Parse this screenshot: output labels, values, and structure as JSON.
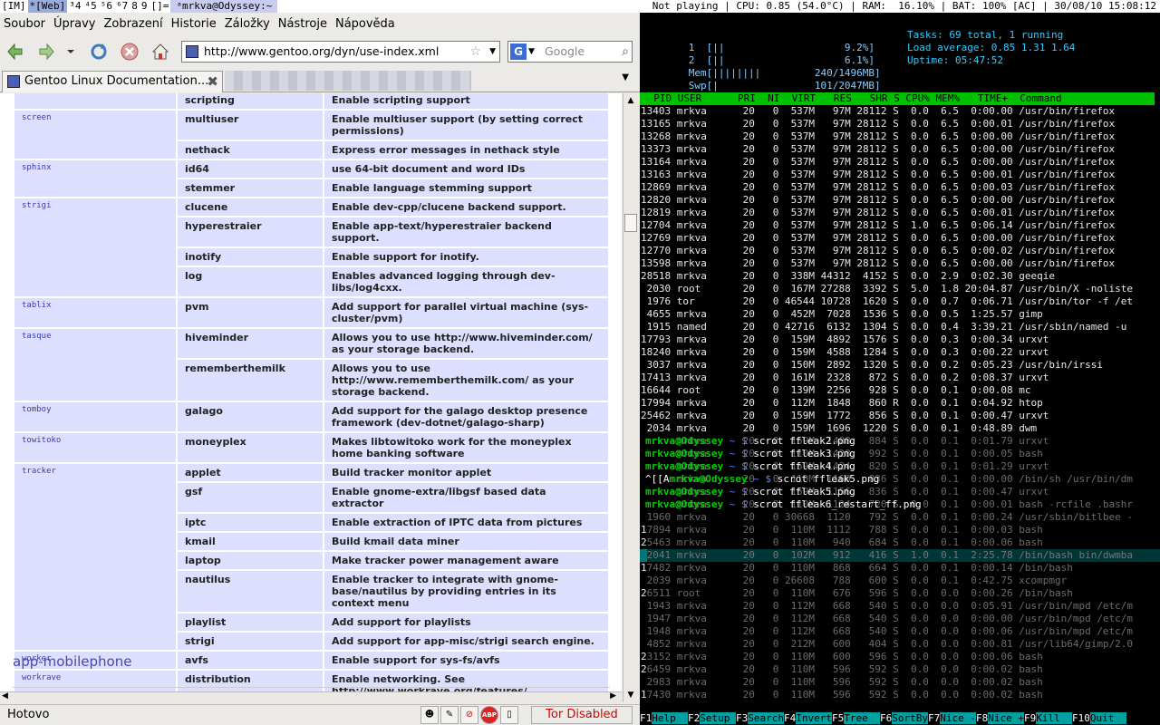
{
  "topbar": {
    "workspaces": [
      "[IM]",
      "*[Web]",
      "³4",
      "⁴5",
      "⁵6",
      "⁶7",
      "8",
      "9",
      "[]="
    ],
    "window_title": "ᵃmrkva@Odyssey:~",
    "status": "Not playing | CPU: 0.85 (54.0°C) | RAM:  16.10% | BAT: 100% [AC] | 30/08/10 15:08:12"
  },
  "firefox": {
    "menu": [
      "Soubor",
      "Úpravy",
      "Zobrazení",
      "Historie",
      "Záložky",
      "Nástroje",
      "Nápověda"
    ],
    "url": "http://www.gentoo.org/dyn/use-index.xml",
    "search_placeholder": "Google",
    "tab_title": "Gentoo Linux Documentation...",
    "status": "Hotovo",
    "tor_status": "Tor Disabled",
    "section_heading": "app-mobilephone",
    "rows": [
      {
        "pkg": "",
        "flag": "scripting",
        "desc": "Enable scripting support"
      },
      {
        "pkg": "screen",
        "flag": "multiuser",
        "desc": "Enable multiuser support (by setting correct permissions)"
      },
      {
        "pkg": "",
        "flag": "nethack",
        "desc": "Express error messages in nethack style"
      },
      {
        "pkg": "sphinx",
        "flag": "id64",
        "desc": "use 64-bit document and word IDs"
      },
      {
        "pkg": "",
        "flag": "stemmer",
        "desc": "Enable language stemming support"
      },
      {
        "pkg": "strigi",
        "flag": "clucene",
        "desc": "Enable dev-cpp/clucene backend support."
      },
      {
        "pkg": "",
        "flag": "hyperestraier",
        "desc": "Enable app-text/hyperestraier backend support."
      },
      {
        "pkg": "",
        "flag": "inotify",
        "desc": "Enable support for inotify."
      },
      {
        "pkg": "",
        "flag": "log",
        "desc": "Enables advanced logging through dev-libs/log4cxx."
      },
      {
        "pkg": "tablix",
        "flag": "pvm",
        "desc": "Add support for parallel virtual machine (sys-cluster/pvm)"
      },
      {
        "pkg": "tasque",
        "flag": "hiveminder",
        "desc": "Allows you to use http://www.hiveminder.com/ as your storage backend."
      },
      {
        "pkg": "",
        "flag": "rememberthemilk",
        "desc": "Allows you to use http://www.rememberthemilk.com/ as your storage backend."
      },
      {
        "pkg": "tomboy",
        "flag": "galago",
        "desc": "Add support for the galago desktop presence framework (dev-dotnet/galago-sharp)"
      },
      {
        "pkg": "towitoko",
        "flag": "moneyplex",
        "desc": "Makes libtowitoko work for the moneyplex home banking software"
      },
      {
        "pkg": "tracker",
        "flag": "applet",
        "desc": "Build tracker monitor applet"
      },
      {
        "pkg": "",
        "flag": "gsf",
        "desc": "Enable gnome-extra/libgsf based data extractor"
      },
      {
        "pkg": "",
        "flag": "iptc",
        "desc": "Enable extraction of IPTC data from pictures"
      },
      {
        "pkg": "",
        "flag": "kmail",
        "desc": "Build kmail data miner"
      },
      {
        "pkg": "",
        "flag": "laptop",
        "desc": "Make tracker power management aware"
      },
      {
        "pkg": "",
        "flag": "nautilus",
        "desc": "Enable tracker to integrate with gnome-base/nautilus by providing entries in its context menu"
      },
      {
        "pkg": "",
        "flag": "playlist",
        "desc": "Add support for playlists"
      },
      {
        "pkg": "",
        "flag": "strigi",
        "desc": "Add support for app-misc/strigi search engine."
      },
      {
        "pkg": "worker",
        "flag": "avfs",
        "desc": "Enable support for sys-fs/avfs"
      },
      {
        "pkg": "workrave",
        "flag": "distribution",
        "desc": "Enable networking. See http://www.workrave.org/features/"
      }
    ]
  },
  "htop": {
    "cpu1": "1  [||                    9.2%]",
    "cpu2": "2  [||                    6.1%]",
    "mem": "Mem[||||||||         240/1496MB]",
    "swp": "Swp[|                101/2047MB]",
    "tasks": "Tasks: 69 total, 1 running",
    "load": "Load average: 0.85 1.31 1.64",
    "uptime": "Uptime: 05:47:52",
    "columns": "  PID USER      PRI  NI  VIRT   RES   SHR S CPU% MEM%   TIME+  Command",
    "processes": [
      "13403 mrkva      20   0  537M   97M 28112 S  0.0  6.5  0:00.00 /usr/bin/firefox",
      "13165 mrkva      20   0  537M   97M 28112 S  0.0  6.5  0:00.01 /usr/bin/firefox",
      "13268 mrkva      20   0  537M   97M 28112 S  0.0  6.5  0:00.00 /usr/bin/firefox",
      "13373 mrkva      20   0  537M   97M 28112 S  0.0  6.5  0:00.00 /usr/bin/firefox",
      "13164 mrkva      20   0  537M   97M 28112 S  0.0  6.5  0:00.00 /usr/bin/firefox",
      "13163 mrkva      20   0  537M   97M 28112 S  0.0  6.5  0:00.01 /usr/bin/firefox",
      "12869 mrkva      20   0  537M   97M 28112 S  0.0  6.5  0:00.03 /usr/bin/firefox",
      "12820 mrkva      20   0  537M   97M 28112 S  0.0  6.5  0:00.00 /usr/bin/firefox",
      "12819 mrkva      20   0  537M   97M 28112 S  0.0  6.5  0:00.01 /usr/bin/firefox",
      "12704 mrkva      20   0  537M   97M 28112 S  1.0  6.5  0:06.14 /usr/bin/firefox",
      "12769 mrkva      20   0  537M   97M 28112 S  0.0  6.5  0:00.00 /usr/bin/firefox",
      "12770 mrkva      20   0  537M   97M 28112 S  0.0  6.5  0:00.02 /usr/bin/firefox",
      "13598 mrkva      20   0  537M   97M 28112 S  0.0  6.5  0:00.00 /usr/bin/firefox",
      "28518 mrkva      20   0  338M 44312  4152 S  0.0  2.9  0:02.30 geeqie",
      " 2030 root       20   0  167M 27288  3392 S  5.0  1.8 20:04.87 /usr/bin/X -noliste",
      " 1976 tor        20   0 46544 10728  1620 S  0.0  0.7  0:06.71 /usr/bin/tor -f /et",
      " 4655 mrkva      20   0  452M  7028  1536 S  0.0  0.5  1:25.57 gimp",
      " 1915 named      20   0 42716  6132  1304 S  0.0  0.4  3:39.21 /usr/sbin/named -u",
      "17793 mrkva      20   0  159M  4892  1576 S  0.0  0.3  0:00.34 urxvt",
      "18240 mrkva      20   0  159M  4588  1284 S  0.0  0.3  0:00.22 urxvt",
      " 3037 mrkva      20   0  150M  2892  1320 S  0.0  0.2  0:05.23 /usr/bin/irssi",
      "17413 mrkva      20   0  161M  2328   872 S  0.0  0.2  0:08.37 urxvt",
      "16644 root       20   0  139M  2256   928 S  0.0  0.1  0:00.08 mc",
      "17994 mrkva      20   0  112M  1848   860 R  0.0  0.1  0:04.92 htop",
      "25462 mrkva      20   0  159M  1772   856 S  0.0  0.1  0:00.47 urxvt",
      " 2034 mrkva      20   0  159M  1696  1220 S  0.0  0.1  0:48.89 dwm",
      "      mrkva      20   0  159M  1488   884 S  0.0  0.1  0:01.79 urxvt",
      "      mrkva      20   0  110M  1428   992 S  0.0  0.1  0:00.05 bash",
      "      mrkva      20   0  159M  1424   820 S  0.0  0.1  0:01.29 urxvt",
      "      mrkva      20   0  110M  1160   836 S  0.0  0.1  0:00.00 /bin/sh /usr/bin/dm",
      "      mrkva      20   0  159M  1156   836 S  0.0  0.1  0:00.47 urxvt",
      "      mrkva      20   0  110M  1124   720 S  0.0  0.1  0:00.01 bash -rcfile .bashr",
      " 1960 mrkva      20   0 30668  1120   792 S  0.0  0.1  0:00.24 /usr/sbin/bitlbee -",
      "17894 mrkva      20   0  110M  1112   788 S  0.0  0.1  0:00.03 bash",
      "25463 mrkva      20   0  110M   940   684 S  0.0  0.1  0:00.06 bash",
      " 2041 mrkva      20   0  102M   912   416 S  1.0  0.1  2:25.78 /bin/bash bin/dwmba",
      "17482 mrkva      20   0  110M   868   664 S  0.0  0.1  0:00.14 /bin/bash",
      " 2039 mrkva      20   0 26608   788   600 S  0.0  0.1  0:42.75 xcompmgr",
      "26511 root       20   0  110M   676   596 S  0.0  0.0  0:00.26 /bin/bash",
      " 1943 mrkva      20   0  112M   668   540 S  0.0  0.0  0:05.91 /usr/bin/mpd /etc/m",
      " 1947 mrkva      20   0  112M   668   540 S  0.0  0.0  0:00.00 /usr/bin/mpd /etc/m",
      " 1948 mrkva      20   0  112M   668   540 S  0.0  0.0  0:00.06 /usr/bin/mpd /etc/m",
      " 4852 mrkva      20   0  212M   600   404 S  0.0  0.0  0:00.81 /usr/lib64/gimp/2.0",
      "23152 mrkva      20   0  110M   600   596 S  0.0  0.0  0:00.06 bash",
      "26459 mrkva      20   0  110M   596   592 S  0.0  0.0  0:00.02 bash",
      " 2983 mrkva      20   0  110M   596   592 S  0.0  0.0  0:00.02 bash",
      "17430 mrkva      20   0  110M   596   592 S  0.0  0.0  0:00.02 bash"
    ],
    "selected_index": 35,
    "fnkeys": [
      {
        "k": "F1",
        "l": "Help  "
      },
      {
        "k": "F2",
        "l": "Setup "
      },
      {
        "k": "F3",
        "l": "Search"
      },
      {
        "k": "F4",
        "l": "Invert"
      },
      {
        "k": "F5",
        "l": "Tree  "
      },
      {
        "k": "F6",
        "l": "SortBy"
      },
      {
        "k": "F7",
        "l": "Nice -"
      },
      {
        "k": "F8",
        "l": "Nice +"
      },
      {
        "k": "F9",
        "l": "Kill  "
      },
      {
        "k": "F10",
        "l": "Quit  "
      }
    ]
  },
  "shell": {
    "prompt_user": "mrkva@Odyssey",
    "lines": [
      {
        "pre": "",
        "path": "~",
        "cmd": "scrot ffleak2.png"
      },
      {
        "pre": "",
        "path": "~",
        "cmd": "scrot ffleak3.png"
      },
      {
        "pre": "",
        "path": "~",
        "cmd": "scrot ffleak4.png"
      },
      {
        "pre": "^[[A",
        "path": "~",
        "cmd": "scrot ffleak5.png"
      },
      {
        "pre": "",
        "path": "~",
        "cmd": "scrot ffleak5.png"
      },
      {
        "pre": "",
        "path": "~",
        "cmd": "scrot ffleak6_restart_ff.png"
      }
    ]
  }
}
